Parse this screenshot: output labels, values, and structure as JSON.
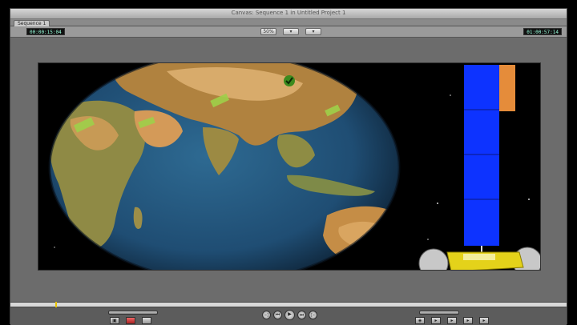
{
  "window": {
    "title": "Canvas: Sequence 1 in Untitled Project 1",
    "tab_label": "Sequence 1",
    "timecode_duration": "00:00:15:04",
    "timecode_current": "01:00:57:14",
    "zoom_label": "50%",
    "view_label": "",
    "overlay_label": ""
  },
  "scrubber": {
    "playhead_fraction": 0.08
  },
  "controls": {
    "play_icon": "play-icon",
    "prev_edit_icon": "previous-edit-icon",
    "next_edit_icon": "next-edit-icon",
    "play_in_out_icon": "play-in-to-out-icon",
    "play_around_icon": "play-around-icon"
  },
  "colors": {
    "playhead": "#e8c300",
    "panel_blue": "#0d33ff",
    "panel_orange": "#e58c3a",
    "ocean": "#234f7a"
  }
}
